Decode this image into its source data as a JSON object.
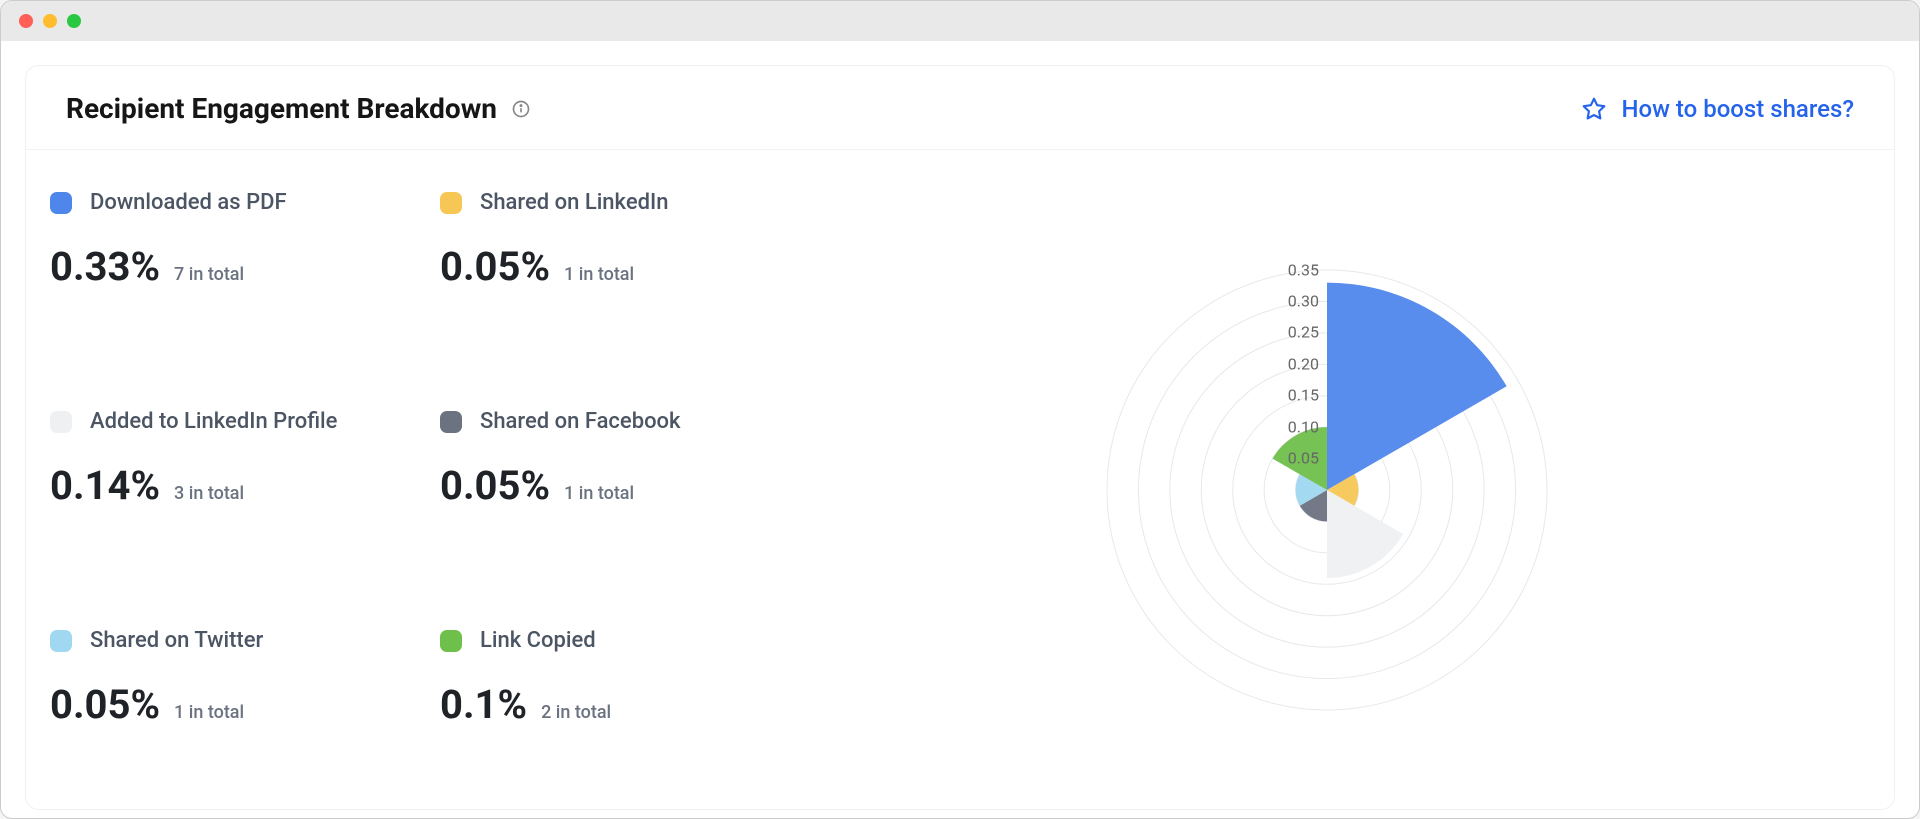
{
  "card": {
    "title": "Recipient Engagement Breakdown",
    "help_link": "How to boost shares?"
  },
  "metrics": [
    {
      "label": "Downloaded as PDF",
      "percent": "0.33%",
      "total": "7 in total",
      "color": "#4f86ec"
    },
    {
      "label": "Shared on LinkedIn",
      "percent": "0.05%",
      "total": "1 in total",
      "color": "#f6c755"
    },
    {
      "label": "Added to LinkedIn Profile",
      "percent": "0.14%",
      "total": "3 in total",
      "color": "#eef0f2"
    },
    {
      "label": "Shared on Facebook",
      "percent": "0.05%",
      "total": "1 in total",
      "color": "#6b7280"
    },
    {
      "label": "Shared on Twitter",
      "percent": "0.05%",
      "total": "1 in total",
      "color": "#9fd8f0"
    },
    {
      "label": "Link Copied",
      "percent": "0.1%",
      "total": "2 in total",
      "color": "#6fbf4b"
    }
  ],
  "chart_data": {
    "type": "polar-area",
    "max": 0.35,
    "ticks": [
      0.35,
      0.3,
      0.25,
      0.2,
      0.15,
      0.1,
      0.05
    ],
    "tick_labels": [
      "0.35",
      "0.30",
      "0.25",
      "0.20",
      "0.15",
      "0.10",
      "0.05"
    ],
    "series": [
      {
        "name": "Downloaded as PDF",
        "value": 0.33,
        "color": "#4f86ec"
      },
      {
        "name": "Shared on LinkedIn",
        "value": 0.05,
        "color": "#f6c755"
      },
      {
        "name": "Added to LinkedIn Profile",
        "value": 0.14,
        "color": "#eef0f2"
      },
      {
        "name": "Shared on Facebook",
        "value": 0.05,
        "color": "#6b7280"
      },
      {
        "name": "Shared on Twitter",
        "value": 0.05,
        "color": "#9fd8f0"
      },
      {
        "name": "Link Copied",
        "value": 0.1,
        "color": "#6fbf4b"
      }
    ]
  }
}
